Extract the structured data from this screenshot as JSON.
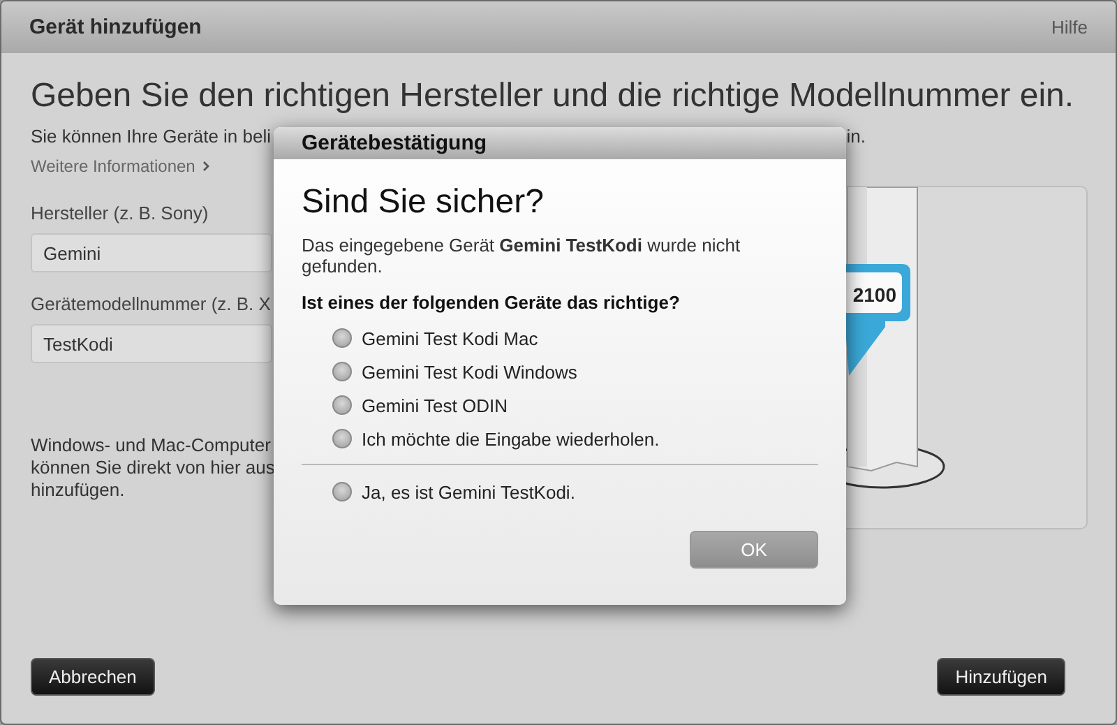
{
  "window": {
    "title": "Gerät hinzufügen",
    "help_link": "Hilfe"
  },
  "page": {
    "heading": "Geben Sie den richtigen Hersteller und die richtige Modellnummer ein.",
    "intro_left": "Sie können Ihre Geräte in beli",
    "intro_right": "in.",
    "more_info_link": "Weitere Informationen",
    "fields": [
      {
        "label": "Hersteller (z. B. Sony)",
        "value": "Gemini"
      },
      {
        "label": "Gerätemodellnummer (z. B. X",
        "value": "TestKodi"
      }
    ],
    "note_lines": [
      "Windows- und Mac-Computer",
      "können Sie direkt von hier aus",
      "hinzufügen."
    ],
    "illustration": {
      "callout": "2100"
    },
    "buttons": [
      {
        "label": "Abbrechen"
      },
      {
        "label": "Hinzufügen"
      }
    ]
  },
  "dialog": {
    "title": "Gerätebestätigung",
    "heading": "Sind Sie sicher?",
    "message": "Das eingegebene Gerät **Gemini TestKodi** wurde nicht gefunden.",
    "question": "Ist eines der folgenden Geräte das richtige?",
    "options": [
      {
        "label": "Gemini Test Kodi Mac",
        "selected": false
      },
      {
        "label": "Gemini Test Kodi Windows",
        "selected": false
      },
      {
        "label": "Gemini Test ODIN",
        "selected": false
      },
      {
        "label": "Ich möchte die Eingabe wiederholen.",
        "selected": false
      }
    ],
    "confirm_option": {
      "label": "Ja, es ist Gemini TestKodi.",
      "selected": false
    },
    "ok_button": {
      "label": "OK",
      "disabled": true
    }
  }
}
